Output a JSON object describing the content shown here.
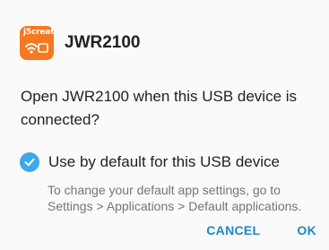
{
  "dialog": {
    "app_icon": "jwr2100-app-icon",
    "app_icon_brand": "j5create",
    "title": "JWR2100",
    "message": "Open JWR2100 when this USB device is connected?",
    "checkbox": {
      "label": "Use by default for this USB device",
      "checked": true,
      "icon": "check-icon"
    },
    "hint": "To change your default app settings, go to Settings > Applications > Default applications.",
    "buttons": {
      "cancel": "CANCEL",
      "ok": "OK"
    }
  },
  "colors": {
    "icon_background": "#f47920",
    "checkbox": "#3ea8e5",
    "button_text": "#1e88c8",
    "hint_text": "#757575"
  }
}
